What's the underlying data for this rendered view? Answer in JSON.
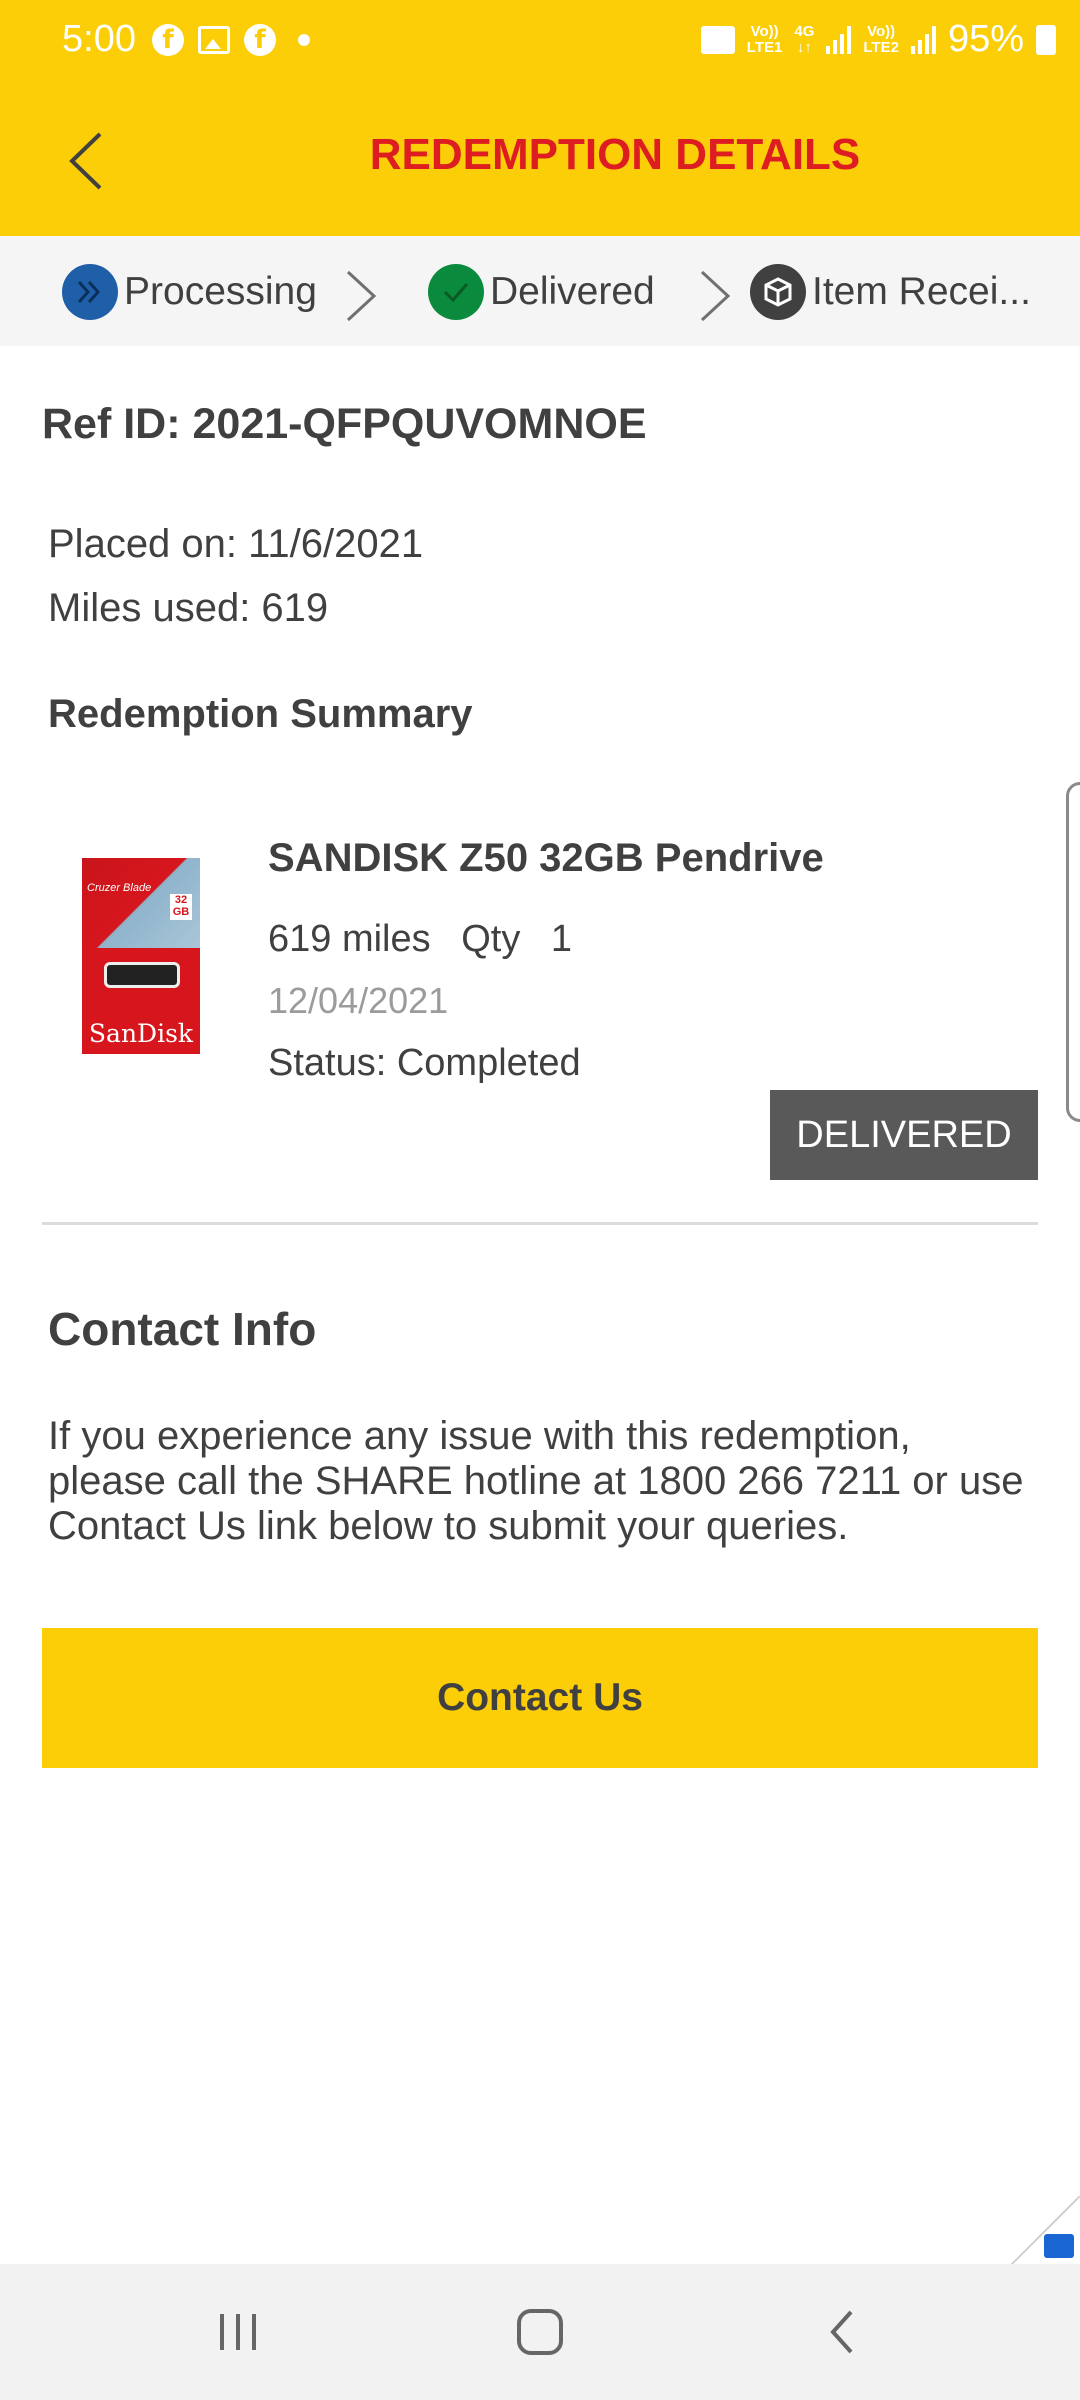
{
  "status_bar": {
    "time": "5:00",
    "battery": "95%",
    "sim1_label_top": "Vo))",
    "sim1_label_bottom": "LTE1",
    "data_label_top": "4G",
    "sim2_label_top": "Vo))",
    "sim2_label_bottom": "LTE2"
  },
  "header": {
    "title": "REDEMPTION DETAILS",
    "back_icon": "chevron-left-icon"
  },
  "steps": [
    {
      "label": "Processing",
      "icon": "double-chevron-right-icon",
      "color": "#1f5fa8"
    },
    {
      "label": "Delivered",
      "icon": "check-icon",
      "color": "#0a8a3c"
    },
    {
      "label": "Item Recei...",
      "icon": "box-icon",
      "color": "#404040"
    }
  ],
  "order": {
    "ref_id": "Ref ID: 2021-QFPQUVOMNOE",
    "placed_on": "Placed on: 11/6/2021",
    "miles_used": "Miles used: 619"
  },
  "summary": {
    "title": "Redemption Summary",
    "item": {
      "name": "SANDISK Z50 32GB Pendrive",
      "miles": "619 miles",
      "qty_label": "Qty",
      "qty": "1",
      "date": "12/04/2021",
      "status": "Status: Completed",
      "delivered_button": "DELIVERED",
      "image": {
        "brand": "SanDisk",
        "product_line": "Cruzer Blade",
        "capacity": "32 GB"
      }
    }
  },
  "contact": {
    "title": "Contact Info",
    "text": "If you experience any issue with this redemption, please call the SHARE hotline at 1800 266 7211 or use Contact Us link below to submit your queries.",
    "button": "Contact Us"
  },
  "colors": {
    "brand_yellow": "#fbce07",
    "title_red": "#dd1d21",
    "text_dark": "#404040",
    "button_grey": "#595959"
  }
}
